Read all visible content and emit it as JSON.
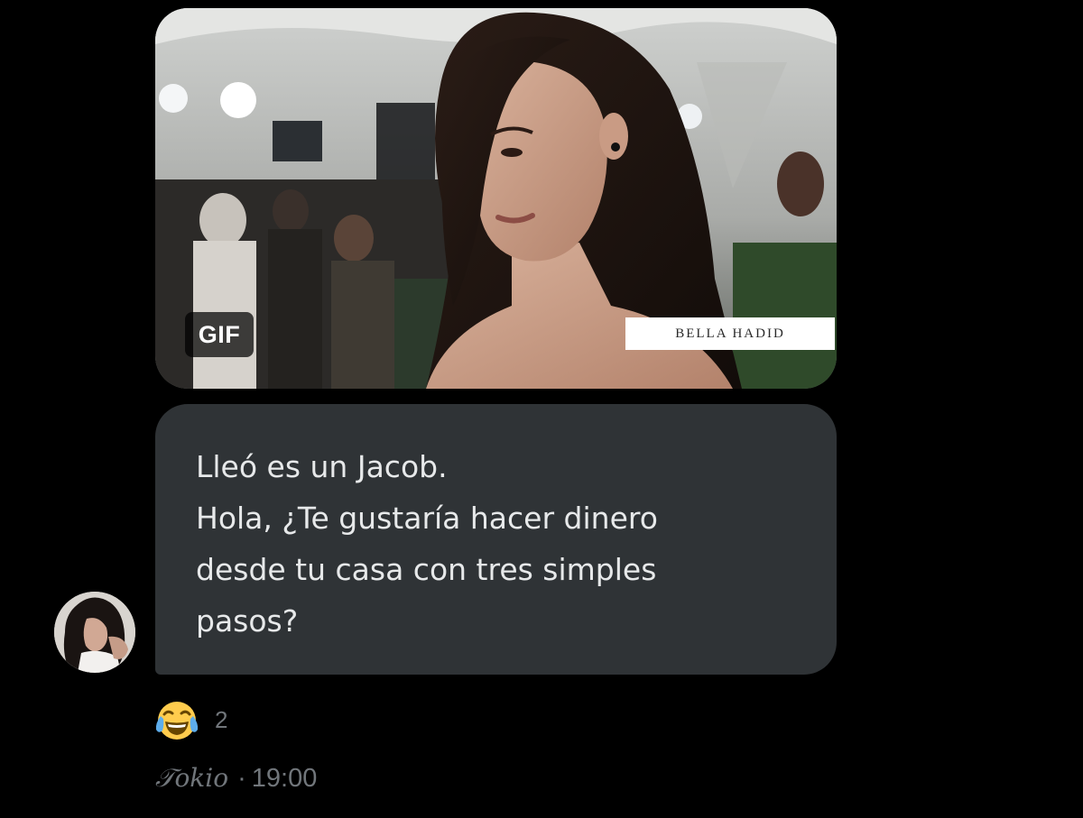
{
  "message": {
    "media": {
      "type_badge": "GIF",
      "caption": "BELLA HADID"
    },
    "text_lines": [
      "Lleó es un Jacob.",
      "Hola, ¿Te gustaría hacer dinero",
      "desde tu casa con tres simples",
      "pasos?"
    ],
    "reaction": {
      "emoji": "face-with-tears-of-joy",
      "count": "2"
    },
    "sender": "𝒯okio",
    "separator": "·",
    "time": "19:00"
  },
  "colors": {
    "background": "#000000",
    "bubble": "#2f3336",
    "text": "#e7e9ea",
    "muted": "#71767b"
  }
}
